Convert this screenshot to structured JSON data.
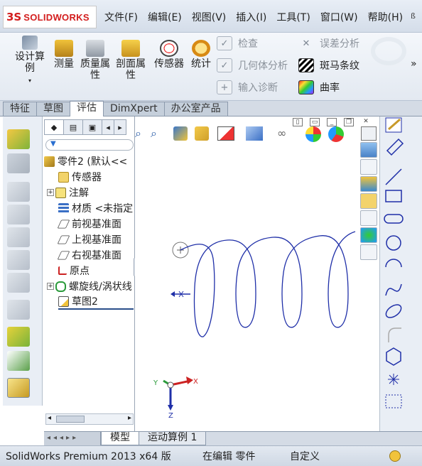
{
  "app": {
    "logo_mark": "3S",
    "logo_text": "SOLIDWORKS"
  },
  "menu": {
    "items": [
      "文件(F)",
      "编辑(E)",
      "视图(V)",
      "插入(I)",
      "工具(T)",
      "窗口(W)",
      "帮助(H)"
    ],
    "overflow": "ß"
  },
  "ribbon": {
    "design_study": "设计算例",
    "measure": "测量",
    "mass_props": "质量属性",
    "section_props": "剖面属性",
    "sensor": "传感器",
    "statistics": "统计",
    "check": "检查",
    "geometry_analysis": "几何体分析",
    "import_diagnostics": "输入诊断",
    "deviation_analysis": "误差分析",
    "zebra_stripes": "斑马条纹",
    "curvature": "曲率",
    "more": "»"
  },
  "tabs": [
    "特征",
    "草图",
    "评估",
    "DimXpert",
    "办公室产品"
  ],
  "active_tab": "评估",
  "feature_tree": {
    "root": "零件2 (默认<<",
    "items": [
      "传感器",
      "注解",
      "材质 <未指定",
      "前视基准面",
      "上视基准面",
      "右视基准面",
      "原点",
      "螺旋线/涡状线",
      "草图2"
    ]
  },
  "bottom_tabs": [
    "模型",
    "运动算例 1"
  ],
  "status": {
    "product": "SolidWorks Premium 2013 x64 版",
    "mode": "在编辑 零件",
    "custom": "自定义"
  },
  "triad": {
    "x": "X",
    "y": "Y",
    "z": "Z"
  },
  "colors": {
    "accent": "#d31d1d",
    "helix": "#1f2fa8",
    "tab_border": "#8c9aad"
  },
  "icons": [
    "design-study-icon",
    "measure-icon",
    "mass-props-icon",
    "section-props-icon",
    "sensor-icon",
    "statistics-icon",
    "check-icon",
    "geometry-analysis-icon",
    "import-diagnostics-icon",
    "deviation-analysis-icon",
    "zebra-stripes-icon",
    "curvature-icon"
  ]
}
